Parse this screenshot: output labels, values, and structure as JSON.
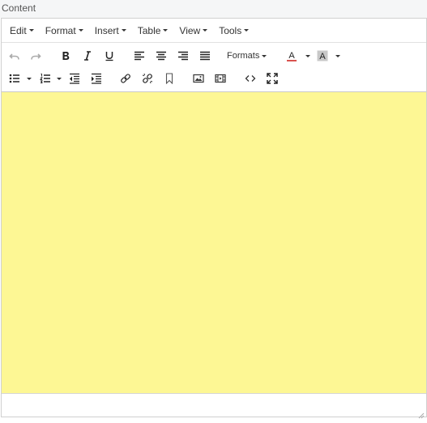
{
  "field": {
    "label": "Content"
  },
  "menubar": {
    "items": [
      {
        "label": "Edit"
      },
      {
        "label": "Format"
      },
      {
        "label": "Insert"
      },
      {
        "label": "Table"
      },
      {
        "label": "View"
      },
      {
        "label": "Tools"
      }
    ]
  },
  "toolbar": {
    "formats_label": "Formats",
    "row1_icons": [
      "undo-icon",
      "redo-icon",
      "bold-icon",
      "italic-icon",
      "underline-icon",
      "align-left-icon",
      "align-center-icon",
      "align-right-icon",
      "align-justify-icon",
      "text-color-icon",
      "background-color-icon"
    ],
    "row2_icons": [
      "bullet-list-icon",
      "numbered-list-icon",
      "outdent-icon",
      "indent-icon",
      "link-icon",
      "unlink-icon",
      "anchor-icon",
      "image-icon",
      "media-icon",
      "source-code-icon",
      "fullscreen-icon"
    ],
    "text_color_glyph": "A",
    "background_color_glyph": "A"
  },
  "colors": {
    "content_background": "#fdf794",
    "text_color_underline": "#d9534f",
    "background_color_swatch": "#c8c8c8"
  }
}
